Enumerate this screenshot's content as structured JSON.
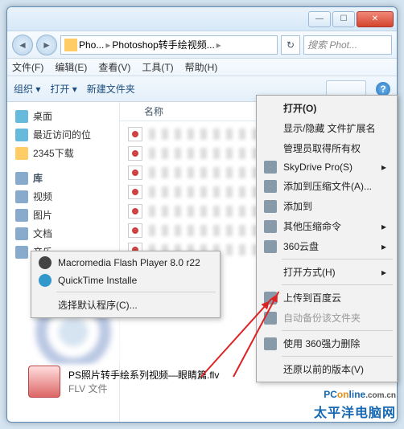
{
  "titlebar": {
    "min": "—",
    "max": "☐",
    "close": "✕"
  },
  "breadcrumb": {
    "item1": "Pho...",
    "item2": "Photoshop转手绘视频...",
    "sep": "▸"
  },
  "search": {
    "placeholder": "搜索 Phot..."
  },
  "menubar": {
    "file": "文件(F)",
    "edit": "编辑(E)",
    "view": "查看(V)",
    "tools": "工具(T)",
    "help": "帮助(H)"
  },
  "toolbar": {
    "organize": "组织 ▾",
    "open": "打开 ▾",
    "newfolder": "新建文件夹"
  },
  "columns": {
    "name": "名称"
  },
  "sidebar": {
    "desktop": "桌面",
    "recent": "最近访问的位",
    "dl2345": "2345下载",
    "lib": "库",
    "video": "视频",
    "pic": "图片",
    "doc": "文档",
    "music": "音乐"
  },
  "contextMain": {
    "open": "打开(O)",
    "showhide": "显示/隐藏 文件扩展名",
    "admin": "管理员取得所有权",
    "skydrive": "SkyDrive Pro(S)",
    "addzip": "添加到压缩文件(A)...",
    "addto": "添加到",
    "otherzip": "其他压缩命令",
    "yun360": "360云盘",
    "openwith": "打开方式(H)",
    "uploadbaidu": "上传到百度云",
    "autobackup": "自动备份该文件夹",
    "forcedel": "使用 360强力删除",
    "restore": "还原以前的版本(V)"
  },
  "contextSub": {
    "flash": "Macromedia Flash Player 8.0  r22",
    "quicktime": "QuickTime Installe",
    "choose": "选择默认程序(C)..."
  },
  "selected": {
    "filename": "PS照片转手绘系列视频—眼睛篇.flv",
    "type": "FLV 文件"
  },
  "watermark": {
    "brand1": "PC",
    "brand2": "on",
    "brand3": "line",
    "domain": ".com.cn",
    "cn": "太平洋电脑网"
  }
}
